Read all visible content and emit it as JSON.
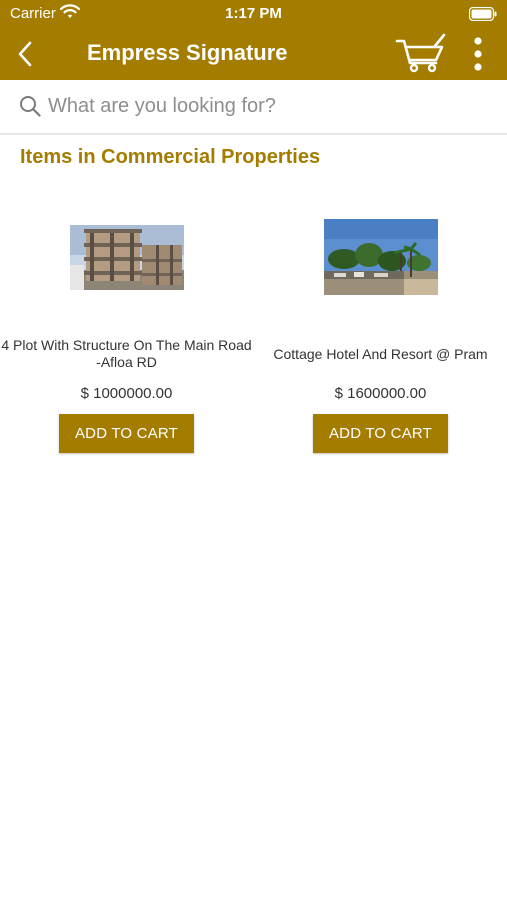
{
  "status_bar": {
    "carrier": "Carrier",
    "time": "1:17 PM"
  },
  "nav": {
    "title": "Empress Signature",
    "back_icon": "chevron-left-icon",
    "cart_icon": "cart-icon",
    "more_icon": "more-vertical-icon"
  },
  "search": {
    "placeholder": "What are you looking for?",
    "value": ""
  },
  "section": {
    "title": "Items in Commercial Properties"
  },
  "products": [
    {
      "name": "4 Plot With Structure On The Main Road -Afloa RD",
      "price": "$ 1000000.00",
      "button_label": "ADD TO CART"
    },
    {
      "name": "Cottage Hotel And Resort @ Pram",
      "price": "$ 1600000.00",
      "button_label": "ADD TO CART"
    }
  ],
  "colors": {
    "brand": "#a47d00",
    "text": "#333333"
  }
}
